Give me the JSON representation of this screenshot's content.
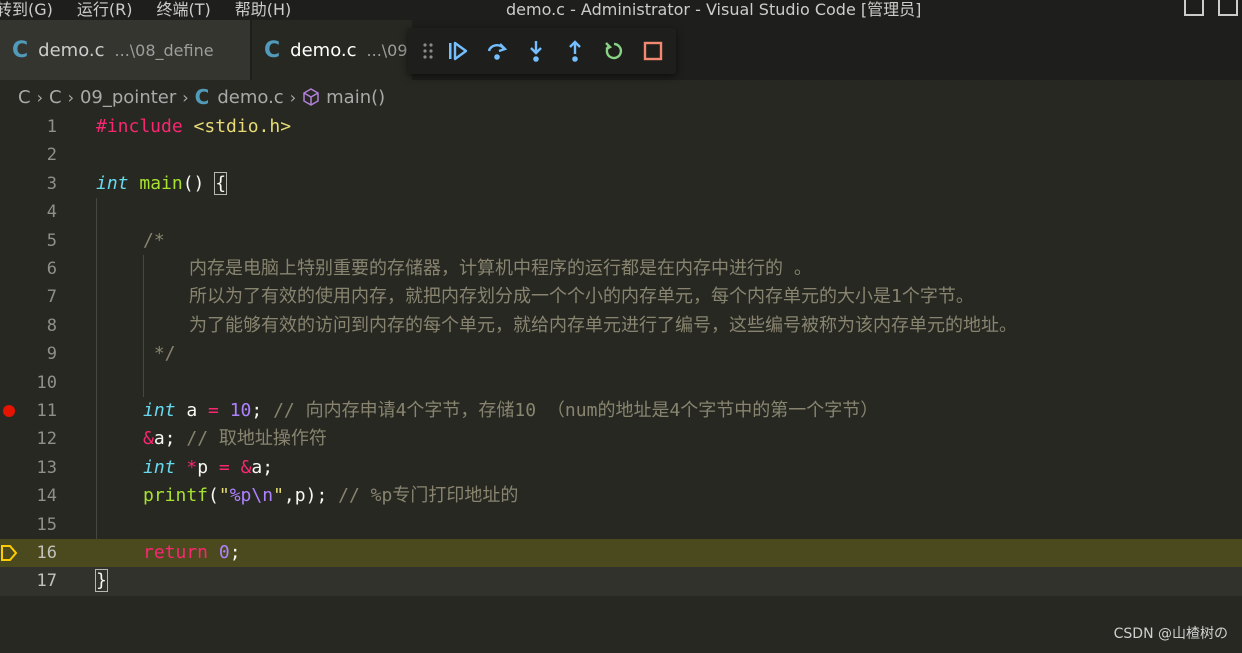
{
  "menu": {
    "items": [
      "转到(G)",
      "运行(R)",
      "终端(T)",
      "帮助(H)"
    ]
  },
  "window": {
    "title": "demo.c - Administrator - Visual Studio Code [管理员]"
  },
  "tabs": [
    {
      "name": "demo.c",
      "path": "...\\08_define",
      "active": false
    },
    {
      "name": "demo.c",
      "path": "...\\09",
      "active": true
    }
  ],
  "debug_toolbar": {
    "buttons": [
      "continue",
      "step-over",
      "step-into",
      "step-out",
      "restart",
      "stop"
    ],
    "colors": {
      "blue": "#75beff",
      "green": "#89d185",
      "red": "#f48771"
    }
  },
  "breadcrumb": {
    "parts": [
      "C",
      "C",
      "09_pointer",
      "demo.c",
      "main()"
    ]
  },
  "editor": {
    "current_line": 16,
    "breakpoint_line": 11,
    "line_numbers": [
      "1",
      "2",
      "3",
      "4",
      "5",
      "6",
      "7",
      "8",
      "9",
      "10",
      "11",
      "12",
      "13",
      "14",
      "15",
      "16",
      "17"
    ],
    "lines": {
      "l1": {
        "pp": "#include",
        "hdr": " <stdio.h>"
      },
      "l3": {
        "type": "int",
        "fn": " main",
        "rest": "() ",
        "brace": "{"
      },
      "l5": "/*",
      "l6": "内存是电脑上特别重要的存储器，计算机中程序的运行都是在内存中进行的 。",
      "l7": "所以为了有效的使用内存，就把内存划分成一个个小的内存单元，每个内存单元的大小是1个字节。",
      "l8": "为了能够有效的访问到内存的每个单元，就给内存单元进行了编号，这些编号被称为该内存单元的地址。",
      "l9": " */",
      "l11": {
        "type": "int",
        "a": " a ",
        "op": "=",
        "num": " 10",
        "semi": ";",
        "comment": " // 向内存申请4个字节，存储10 （num的地址是4个字节中的第一个字节）"
      },
      "l12": {
        "amp": "&",
        "a": "a;",
        "comment": " // 取地址操作符"
      },
      "l13": {
        "type": "int",
        "star": " *",
        "p": "p ",
        "op": "=",
        "amp": " &",
        "a": "a;"
      },
      "l14": {
        "fn": "printf",
        "open": "(",
        "str1": "\"",
        "fmt": "%p\\n",
        "str2": "\"",
        "args": ",p",
        "close": ");",
        "comment": " // %p专门打印地址的"
      },
      "l16": {
        "kw": "return",
        "num": " 0",
        "semi": ";"
      },
      "l17": "}"
    }
  },
  "watermark": "CSDN @山楂树の"
}
